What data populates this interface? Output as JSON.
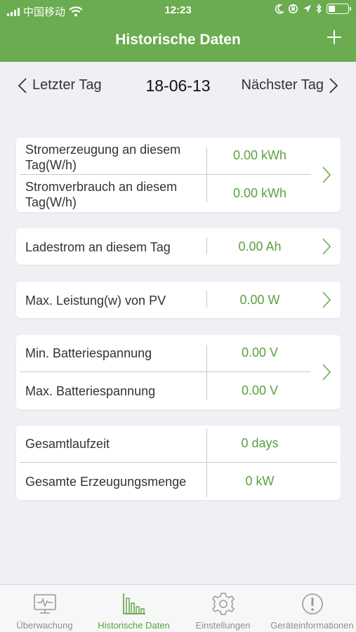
{
  "status": {
    "carrier": "中国移动",
    "time": "12:23"
  },
  "header": {
    "title": "Historische Daten",
    "add_icon": "plus-icon"
  },
  "date_nav": {
    "prev_label": "Letzter Tag",
    "date": "18-06-13",
    "next_label": "Nächster Tag"
  },
  "cards": {
    "energy": {
      "generation_label": "Stromerzeugung an diesem Tag(W/h)",
      "generation_value": "0.00 kWh",
      "consumption_label": "Stromverbrauch  an diesem Tag(W/h)",
      "consumption_value": "0.00 kWh"
    },
    "charge": {
      "label": "Ladestrom an diesem Tag",
      "value": "0.00 Ah"
    },
    "pv": {
      "label": "Max. Leistung(w) von PV",
      "value": "0.00 W"
    },
    "battery": {
      "min_label": "Min. Batteriespannung",
      "min_value": "0.00 V",
      "max_label": "Max. Batteriespannung",
      "max_value": "0.00 V"
    },
    "totals": {
      "runtime_label": "Gesamtlaufzeit",
      "runtime_value": "0 days",
      "generation_label": "Gesamte Erzeugungsmenge",
      "generation_value": "0 kW"
    }
  },
  "tabs": [
    {
      "label": "Überwachung",
      "icon": "monitor-icon",
      "active": false
    },
    {
      "label": "Historische Daten",
      "icon": "bar-chart-icon",
      "active": true
    },
    {
      "label": "Einstellungen",
      "icon": "gear-icon",
      "active": false
    },
    {
      "label": "Geräteinformationen",
      "icon": "info-icon",
      "active": false
    }
  ],
  "colors": {
    "header_green": "#6aac4f",
    "value_green": "#5aa23f",
    "background": "#efeff4"
  }
}
